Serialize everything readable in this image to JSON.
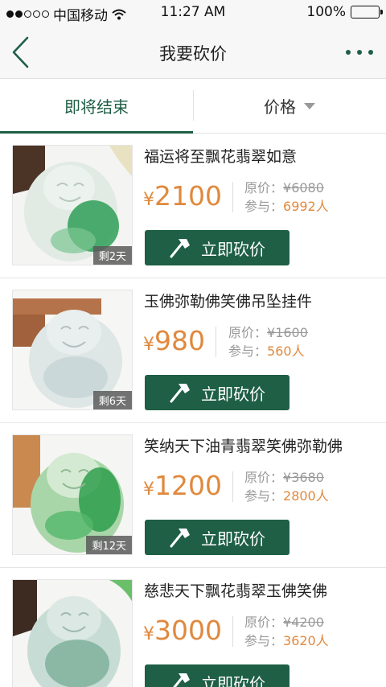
{
  "status_bar": {
    "carrier": "中国移动",
    "time": "11:27 AM",
    "battery": "100%",
    "battery_level": 1.0,
    "signal_bars_filled": 2,
    "signal_bars_total": 5
  },
  "nav": {
    "title": "我要砍价",
    "back_icon": "chevron-left-icon",
    "more_icon": "more-dots-icon"
  },
  "tabs": [
    {
      "label": "即将结束",
      "active": true
    },
    {
      "label": "价格",
      "active": false,
      "icon": "caret-down-icon"
    }
  ],
  "labels": {
    "original_price": "原价：",
    "participants": "参与：",
    "people_unit": "人",
    "currency": "¥",
    "bargain_button": "立即砍价",
    "bargain_icon": "axe-icon"
  },
  "theme": {
    "accent": "#1e5f46",
    "price_color": "#e0893d"
  },
  "items": [
    {
      "title": "福运将至飘花翡翠如意",
      "price": "2100",
      "original_price": "¥6080",
      "participants": "6992",
      "days_left": "剩2天"
    },
    {
      "title": "玉佛弥勒佛笑佛吊坠挂件",
      "price": "980",
      "original_price": "¥1600",
      "participants": "560",
      "days_left": "剩6天"
    },
    {
      "title": "笑纳天下油青翡翠笑佛弥勒佛",
      "price": "1200",
      "original_price": "¥3680",
      "participants": "2800",
      "days_left": "剩12天"
    },
    {
      "title": "慈悲天下飘花翡翠玉佛笑佛",
      "price": "3000",
      "original_price": "¥4200",
      "participants": "3620",
      "days_left": ""
    }
  ]
}
